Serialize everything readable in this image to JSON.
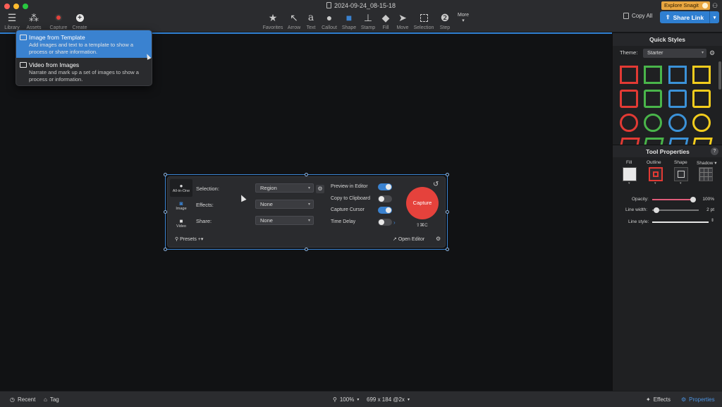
{
  "window": {
    "title": "2024-09-24_08-15-18"
  },
  "toolbar": {
    "left_tools": [
      {
        "name": "library",
        "label": "Library"
      },
      {
        "name": "assets",
        "label": "Assets"
      },
      {
        "name": "capture",
        "label": "Capture"
      },
      {
        "name": "create",
        "label": "Create"
      }
    ],
    "tools": [
      {
        "name": "favorites",
        "label": "Favorites"
      },
      {
        "name": "arrow",
        "label": "Arrow"
      },
      {
        "name": "text",
        "label": "Text"
      },
      {
        "name": "callout",
        "label": "Callout"
      },
      {
        "name": "shape",
        "label": "Shape"
      },
      {
        "name": "stamp",
        "label": "Stamp"
      },
      {
        "name": "fill",
        "label": "Fill"
      },
      {
        "name": "move",
        "label": "Move"
      },
      {
        "name": "selection",
        "label": "Selection"
      },
      {
        "name": "step",
        "label": "Step"
      }
    ],
    "more_label": "More",
    "explore_label": "Explore Snagit",
    "copy_all_label": "Copy All",
    "share_link_label": "Share Link"
  },
  "create_menu": {
    "items": [
      {
        "title": "Image from Template",
        "desc_line1": "Add images and text to a template to show a",
        "desc_line2": "process or share information."
      },
      {
        "title": "Video from Images",
        "desc_line1": "Narrate and mark up a set of images to show a",
        "desc_line2": "process or information."
      }
    ]
  },
  "capture_window": {
    "modes": [
      {
        "label": "All-in-One",
        "icon": "circle-icon"
      },
      {
        "label": "Image",
        "icon": "camera-icon"
      },
      {
        "label": "Video",
        "icon": "video-icon"
      }
    ],
    "selection_label": "Selection:",
    "selection_value": "Region",
    "effects_label": "Effects:",
    "effects_value": "None",
    "share_label": "Share:",
    "share_value": "None",
    "options": [
      {
        "label": "Preview in Editor",
        "on": true
      },
      {
        "label": "Copy to Clipboard",
        "on": false
      },
      {
        "label": "Capture Cursor",
        "on": true
      },
      {
        "label": "Time Delay",
        "on": false
      }
    ],
    "capture_button_label": "Capture",
    "capture_shortcut": "⇧⌘C",
    "presets_label": "Presets",
    "open_editor_label": "Open Editor"
  },
  "quick_styles": {
    "header": "Quick Styles",
    "theme_label": "Theme:",
    "theme_value": "Starter",
    "colors": [
      "#e23a34",
      "#49b54a",
      "#3b92d8",
      "#f2cc1d"
    ]
  },
  "tool_properties": {
    "header": "Tool Properties",
    "help": "?",
    "columns": [
      "Fill",
      "Outline",
      "Shape",
      "Shadow"
    ],
    "opacity_label": "Opacity:",
    "opacity_value": "100%",
    "opacity_level": 1.0,
    "line_width_label": "Line width:",
    "line_width_value": "2 pt",
    "line_style_label": "Line style:"
  },
  "statusbar": {
    "recent_label": "Recent",
    "tag_label": "Tag",
    "zoom_label": "100%",
    "dimensions_label": "699 x 184 @2x",
    "effects_label": "Effects",
    "properties_label": "Properties"
  }
}
